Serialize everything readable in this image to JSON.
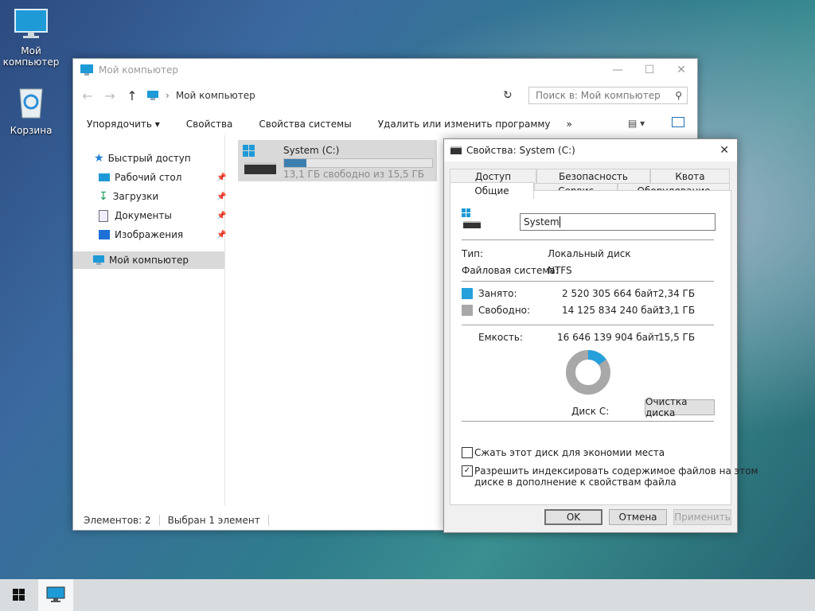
{
  "desktop": {
    "icons": [
      {
        "label": "Мой компьютер"
      },
      {
        "label": "Корзина"
      }
    ]
  },
  "explorer": {
    "title": "Мой компьютер",
    "breadcrumb": "Мой компьютер",
    "search_placeholder": "Поиск в: Мой компьютер",
    "toolbar": {
      "organize": "Упорядочить",
      "properties": "Свойства",
      "system_properties": "Свойства системы",
      "uninstall": "Удалить или изменить программу",
      "more": "»"
    },
    "sidebar": {
      "quick_access": "Быстрый доступ",
      "items": [
        {
          "label": "Рабочий стол"
        },
        {
          "label": "Загрузки"
        },
        {
          "label": "Документы"
        },
        {
          "label": "Изображения"
        }
      ],
      "this_pc": "Мой компьютер"
    },
    "drive": {
      "name": "System (C:)",
      "free_text": "13,1 ГБ свободно из 15,5 ГБ",
      "used_fraction": 0.15
    },
    "status": {
      "items": "Элементов: 2",
      "selected": "Выбран 1 элемент"
    }
  },
  "dialog": {
    "title": "Свойства: System (C:)",
    "tabs_top": [
      "Доступ",
      "Безопасность",
      "Квота"
    ],
    "tabs_bottom": [
      "Общие",
      "Сервис",
      "Оборудование"
    ],
    "name_value": "System",
    "type_label": "Тип:",
    "type_value": "Локальный диск",
    "fs_label": "Файловая система:",
    "fs_value": "NTFS",
    "used_label": "Занято:",
    "used_bytes": "2 520 305 664 байт",
    "used_gb": "2,34 ГБ",
    "free_label": "Свободно:",
    "free_bytes": "14 125 834 240 байт",
    "free_gb": "13,1 ГБ",
    "capacity_label": "Емкость:",
    "capacity_bytes": "16 646 139 904 байт",
    "capacity_gb": "15,5 ГБ",
    "disk_label": "Диск C:",
    "cleanup_button": "Очистка диска",
    "compress_label": "Сжать этот диск для экономии места",
    "compress_checked": false,
    "index_label_line1": "Разрешить индексировать содержимое файлов на этом",
    "index_label_line2": "диске в дополнение к свойствам файла",
    "index_checked": true,
    "ok": "OK",
    "cancel": "Отмена",
    "apply": "Применить",
    "used_fraction": 0.1514,
    "colors": {
      "used": "#26a0da",
      "free": "#a8a8a8"
    }
  }
}
